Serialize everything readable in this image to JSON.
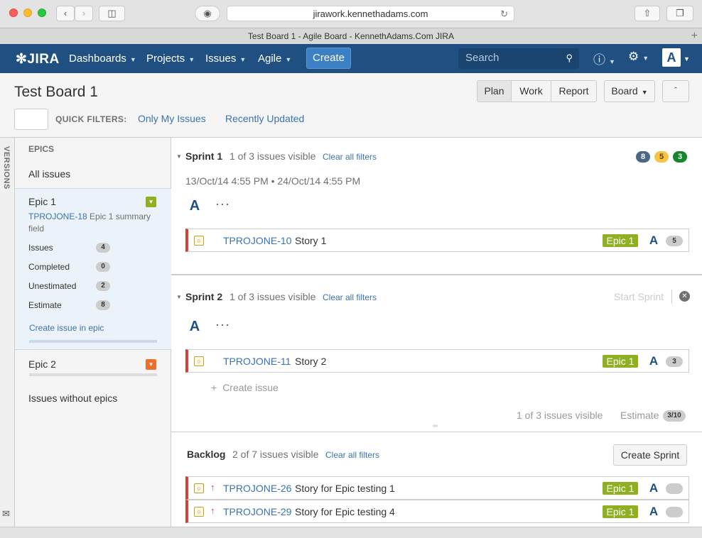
{
  "browser": {
    "url": "jirawork.kennethadams.com",
    "tab_title": "Test Board 1 - Agile Board - KennethAdams.Com JIRA"
  },
  "nav": {
    "logo": "JIRA",
    "items": [
      {
        "label": "Dashboards"
      },
      {
        "label": "Projects"
      },
      {
        "label": "Issues"
      },
      {
        "label": "Agile"
      }
    ],
    "create_label": "Create",
    "search_placeholder": "Search"
  },
  "board": {
    "title": "Test Board 1",
    "modes": [
      "Plan",
      "Work",
      "Report"
    ],
    "active_mode": "Plan",
    "board_menu": "Board",
    "quick_filters_label": "QUICK FILTERS:",
    "quick_filters": [
      "Only My Issues",
      "Recently Updated"
    ]
  },
  "sidebar": {
    "versions_label": "VERSIONS",
    "epics_title": "EPICS",
    "all_issues": "All issues",
    "epic1": {
      "name": "Epic 1",
      "key": "TPROJONE-18",
      "summary": "Epic 1 summary field",
      "color": "#8eb021",
      "stats": [
        {
          "label": "Issues",
          "count": "4"
        },
        {
          "label": "Completed",
          "count": "0"
        },
        {
          "label": "Unestimated",
          "count": "2"
        },
        {
          "label": "Estimate",
          "count": "8"
        }
      ],
      "create_link": "Create issue in epic"
    },
    "epic2": {
      "name": "Epic 2",
      "color": "#f06d2a"
    },
    "without_epics": "Issues without epics"
  },
  "sprint1": {
    "name": "Sprint 1",
    "visible": "1 of 3 issues visible",
    "clear": "Clear all filters",
    "dates": "13/Oct/14 4:55 PM • 24/Oct/14 4:55 PM",
    "badges": [
      {
        "value": "8",
        "color": "#4a6785"
      },
      {
        "value": "5",
        "color": "#f6c342"
      },
      {
        "value": "3",
        "color": "#14892c"
      }
    ],
    "issue": {
      "key": "TPROJONE-10",
      "summary": "Story 1",
      "epic": "Epic 1",
      "estimate": "5"
    }
  },
  "sprint2": {
    "name": "Sprint 2",
    "visible": "1 of 3 issues visible",
    "clear": "Clear all filters",
    "start_sprint": "Start Sprint",
    "issue": {
      "key": "TPROJONE-11",
      "summary": "Story 2",
      "epic": "Epic 1",
      "estimate": "3"
    },
    "create_issue": "Create issue",
    "footer_visible": "1 of 3 issues visible",
    "footer_estimate_label": "Estimate",
    "footer_estimate": "3/10"
  },
  "backlog": {
    "name": "Backlog",
    "visible": "2 of 7 issues visible",
    "clear": "Clear all filters",
    "create_sprint": "Create Sprint",
    "issues": [
      {
        "key": "TPROJONE-26",
        "summary": "Story for Epic testing 1",
        "epic": "Epic 1"
      },
      {
        "key": "TPROJONE-29",
        "summary": "Story for Epic testing 4",
        "epic": "Epic 1"
      }
    ]
  }
}
